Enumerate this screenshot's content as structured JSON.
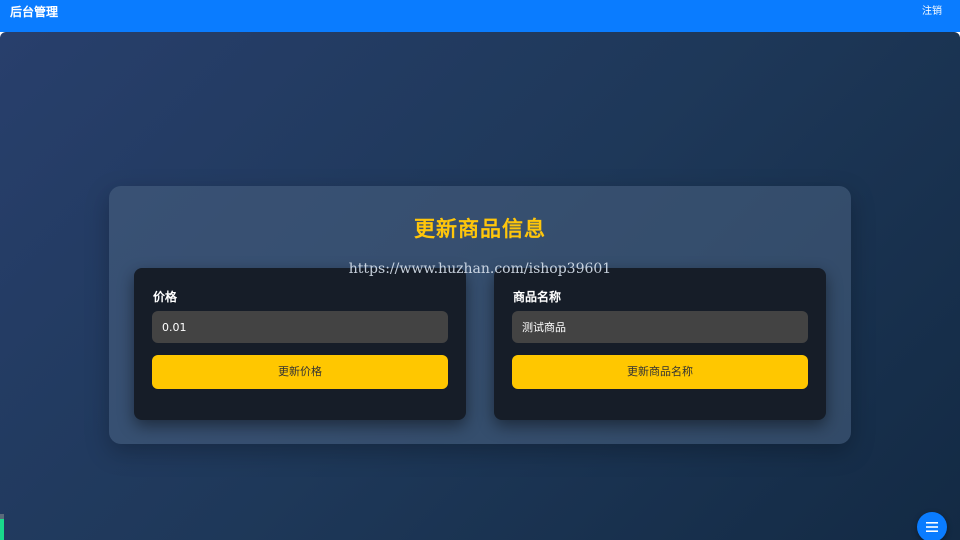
{
  "header": {
    "brand": "后台管理",
    "logout_label": "注销"
  },
  "panel": {
    "title": "更新商品信息",
    "watermark": "https://www.huzhan.com/ishop39601"
  },
  "price_card": {
    "label": "价格",
    "input_value": "0.01",
    "button_label": "更新价格"
  },
  "name_card": {
    "label": "商品名称",
    "input_value": "测试商品",
    "button_label": "更新商品名称"
  },
  "fab": {
    "icon": "menu-icon"
  },
  "colors": {
    "header_bg": "#0a7cff",
    "accent_yellow": "#ffc700",
    "title_yellow": "#ffc60b",
    "card_bg": "#161d28",
    "input_bg": "#434343"
  }
}
